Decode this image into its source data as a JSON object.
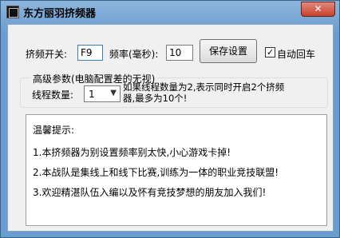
{
  "window": {
    "title": "东方丽羽挤频器",
    "close_glyph": "✕"
  },
  "form": {
    "squeeze_switch_label": "挤频开关:",
    "squeeze_switch_value": "F9",
    "frequency_label": "频率(毫秒):",
    "frequency_value": "10",
    "save_button": "保存设置",
    "auto_enter_label": "自动回车",
    "auto_enter_checked": true
  },
  "advanced": {
    "legend": "高级参数(电脑配置差的无视)",
    "thread_count_label": "线程数量:",
    "thread_count_value": "1",
    "thread_hint_line1": "如果线程数量为2,表示同时开启2个挤频",
    "thread_hint_line2": "器,最多为10个!"
  },
  "notice": {
    "title": "温馨提示:",
    "lines": [
      "1.本挤频器为别设置频率别太快,小心游戏卡掉!",
      "2.本战队是集线上和线下比赛,训练为一体的职业竞技联盟!",
      "3.欢迎精湛队伍入编以及怀有竞技梦想的朋友加入我们!"
    ]
  }
}
